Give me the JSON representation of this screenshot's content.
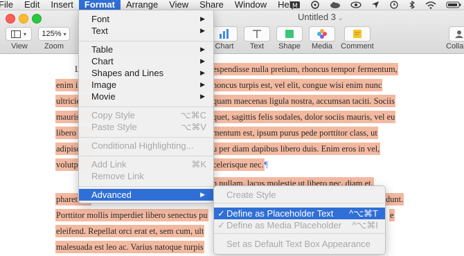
{
  "menubar": {
    "items": [
      "File",
      "Edit",
      "Insert",
      "Format",
      "Arrange",
      "View",
      "Share",
      "Window",
      "Help"
    ],
    "active": "Format"
  },
  "window": {
    "title": "Untitled 3",
    "zoom": "125%",
    "toolbar_labels": {
      "view": "View",
      "zoom": "Zoom",
      "chart": "Chart",
      "text": "Text",
      "shape": "Shape",
      "media": "Media",
      "comment": "Comment",
      "collab": "Collab"
    }
  },
  "format_menu": {
    "groups": [
      [
        {
          "label": "Font",
          "submenu": true,
          "enabled": true
        },
        {
          "label": "Text",
          "submenu": true,
          "enabled": true
        }
      ],
      [
        {
          "label": "Table",
          "submenu": true,
          "enabled": true
        },
        {
          "label": "Chart",
          "submenu": true,
          "enabled": true
        },
        {
          "label": "Shapes and Lines",
          "submenu": true,
          "enabled": true
        },
        {
          "label": "Image",
          "submenu": true,
          "enabled": true
        },
        {
          "label": "Movie",
          "submenu": true,
          "enabled": true
        }
      ],
      [
        {
          "label": "Copy Style",
          "shortcut": "⌥⌘C",
          "enabled": false
        },
        {
          "label": "Paste Style",
          "shortcut": "⌥⌘V",
          "enabled": false
        }
      ],
      [
        {
          "label": "Conditional Highlighting...",
          "enabled": false
        }
      ],
      [
        {
          "label": "Add Link",
          "shortcut": "⌘K",
          "enabled": false
        },
        {
          "label": "Remove Link",
          "enabled": false
        }
      ],
      [
        {
          "label": "Advanced",
          "submenu": true,
          "enabled": true,
          "selected": true
        }
      ]
    ]
  },
  "advanced_menu": {
    "items": [
      {
        "label": "Create Style",
        "enabled": false
      },
      {
        "label": "Define as Placeholder Text",
        "shortcut": "^⌥⌘T",
        "checked": true,
        "selected": true,
        "enabled": true
      },
      {
        "label": "Define as Media Placeholder",
        "shortcut": "^⌥⌘I",
        "checked": true,
        "enabled": false
      },
      {
        "label": "Set as Default Text Box Appearance",
        "enabled": false
      }
    ]
  },
  "document": {
    "lines": [
      "espendisse nulla pretium, rhoncus tempor fermentum,",
      "enim i",
      "honcus turpis est, vel elit, congue wisi enim nunc",
      "ultricie",
      "quam maecenas ligula nostra, accumsan taciti. Sociis",
      "mauris",
      "quet, sagittis felis sodales, dolor sociis mauris, vel eu",
      "libero",
      "mentum est, ipsum purus pede porttitor class, ut",
      "adipisc",
      "u per diam dapibus libero duis. Enim eros in vel,",
      "volutp",
      "celerisque nec.",
      "n nullam, lacus molestie ut libero nec, diam et,",
      "pharet",
      "dunt.",
      "Porttitor mollis imperdiet libero senectus pu",
      "e",
      "eleifend. Repellat orci erat et, sem cum, ult",
      "malesuada est leo ac. Varius natoque turpis"
    ]
  },
  "colors": {
    "selection_blue": "#2f6fd6",
    "text_highlight": "#f3b9a0"
  }
}
